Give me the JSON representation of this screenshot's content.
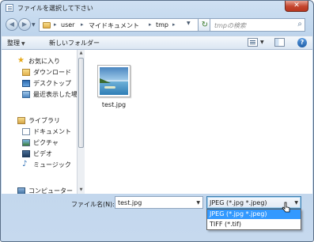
{
  "window": {
    "title": "ファイルを選択して下さい",
    "close_label": "✕"
  },
  "address_bar": {
    "crumbs": [
      "user",
      "マイドキュメント",
      "tmp"
    ],
    "search_placeholder": "tmpの検索"
  },
  "toolbar": {
    "organize": "整理",
    "new_folder": "新しいフォルダー"
  },
  "nav": {
    "favorites": {
      "header": "お気に入り",
      "items": [
        "ダウンロード",
        "デスクトップ",
        "最近表示した場所"
      ]
    },
    "libraries": {
      "header": "ライブラリ",
      "items": [
        "ドキュメント",
        "ピクチャ",
        "ビデオ",
        "ミュージック"
      ]
    },
    "computer": {
      "header": "コンピューター"
    }
  },
  "files": [
    {
      "name": "test.jpg"
    }
  ],
  "bottom": {
    "filename_label": "ファイル名(N):",
    "filename_value": "test.jpg",
    "filetype_selected": "JPEG (*.jpg *.jpeg)",
    "filetype_options": [
      "JPEG (*.jpg *.jpeg)",
      "TIFF (*.tif)"
    ]
  },
  "colors": {
    "selection": "#3399ff",
    "frame": "#b9d1ea",
    "close_button": "#c4452e"
  }
}
